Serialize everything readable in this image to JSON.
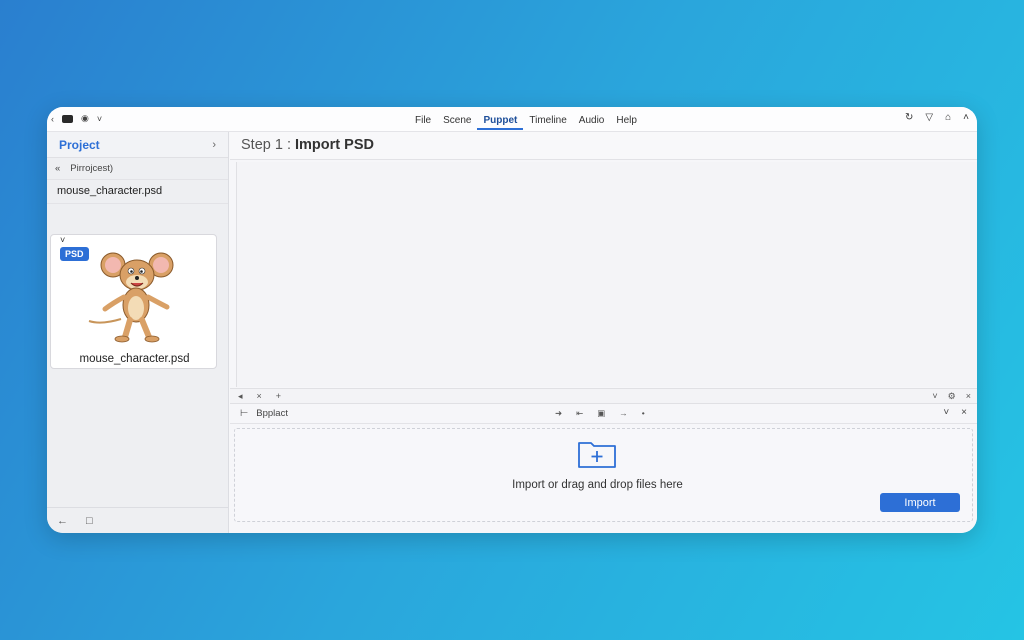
{
  "topbar": {
    "menu": [
      "File",
      "Scene",
      "Puppet",
      "Timeline",
      "Audio",
      "Help"
    ],
    "active_menu": "Puppet"
  },
  "project_panel": {
    "title": "Project",
    "path_label": "Pirrojcest)",
    "file_item": "mouse_character.psd",
    "badge": "PSD",
    "thumb_name": "mouse_character.psd"
  },
  "main": {
    "step_prefix": "Step 1 :",
    "step_title": "Import PSD"
  },
  "dock": {
    "panel_label": "Bpplact",
    "drop_text": "Import or drag and drop files here",
    "import_label": "Import"
  },
  "colors": {
    "accent": "#2d6fd6",
    "background_gradient_start": "#2a7fcf",
    "background_gradient_end": "#25c4e4"
  }
}
